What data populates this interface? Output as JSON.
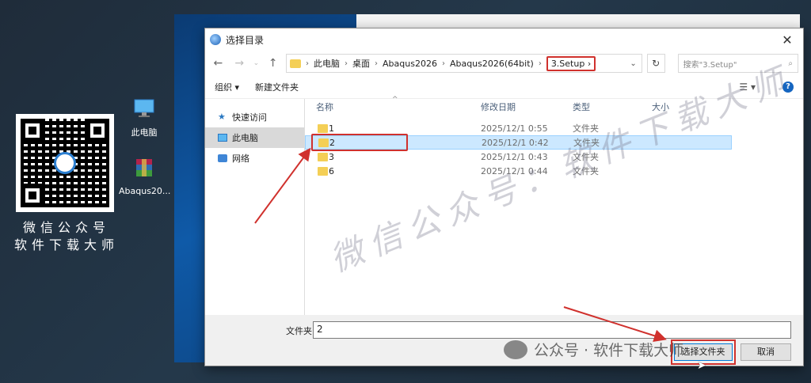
{
  "desktop": {
    "qr_caption_line1": "微信公众号",
    "qr_caption_line2": "软件下载大师",
    "icons": [
      {
        "label": "此电脑",
        "icon": "computer-icon"
      },
      {
        "label": "Abaqus20...",
        "icon": "winrar-icon"
      }
    ]
  },
  "dialog": {
    "title": "选择目录",
    "address": {
      "crumbs": [
        "此电脑",
        "桌面",
        "Abaqus2026",
        "Abaqus2026(64bit)",
        "3.Setup"
      ],
      "current": "3.Setup"
    },
    "search_placeholder": "搜索\"3.Setup\"",
    "toolbar": {
      "organize": "组织 ▾",
      "new_folder": "新建文件夹"
    },
    "nav_pane": [
      {
        "label": "快速访问",
        "icon": "star-icon"
      },
      {
        "label": "此电脑",
        "icon": "computer-icon",
        "selected": true
      },
      {
        "label": "网络",
        "icon": "network-icon"
      }
    ],
    "columns": {
      "name": "名称",
      "date": "修改日期",
      "type": "类型",
      "size": "大小"
    },
    "rows": [
      {
        "name": "1",
        "date": "2025/12/1 0:55",
        "type": "文件夹"
      },
      {
        "name": "2",
        "date": "2025/12/1 0:42",
        "type": "文件夹",
        "selected": true
      },
      {
        "name": "3",
        "date": "2025/12/1 0:43",
        "type": "文件夹"
      },
      {
        "name": "6",
        "date": "2025/12/1 0:44",
        "type": "文件夹"
      }
    ],
    "footer": {
      "folder_label": "文件夹:",
      "folder_value": "2",
      "select_button": "选择文件夹",
      "cancel_button": "取消"
    }
  },
  "watermarks": {
    "diagonal": "微信公众号：软件下载大师",
    "bottom": "公众号 · 软件下载大师"
  },
  "colors": {
    "highlight": "#d0312d",
    "selection": "#cce8ff",
    "folder": "#f4cf56"
  }
}
